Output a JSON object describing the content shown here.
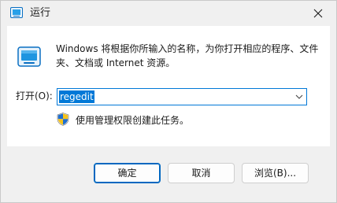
{
  "window": {
    "title": "运行",
    "title_icon": "run-icon",
    "close_icon": "close-icon"
  },
  "description": "Windows 将根据你所输入的名称，为你打开相应的程序、文件夹、文档或 Internet 资源。",
  "open": {
    "label": "打开(O):",
    "value": "regedit",
    "dropdown_icon": "chevron-down-icon"
  },
  "admin_note": {
    "icon": "uac-shield-icon",
    "text": "使用管理权限创建此任务。"
  },
  "buttons": {
    "ok": "确定",
    "cancel": "取消",
    "browse": "浏览(B)..."
  },
  "colors": {
    "accent": "#0078d7",
    "selection_bg": "#0078d7",
    "default_button_border": "#0067c0"
  }
}
